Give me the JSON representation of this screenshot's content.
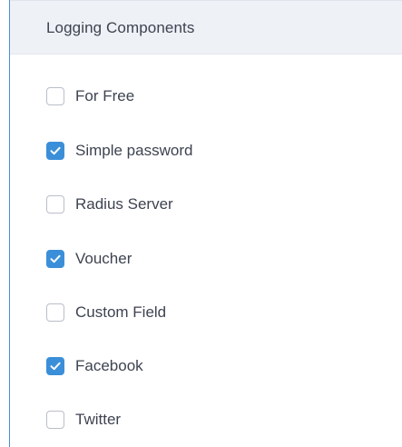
{
  "panel": {
    "title": "Logging Components"
  },
  "colors": {
    "accent": "#3b8fd9",
    "header_background": "#eef1f6",
    "text": "#3d4350"
  },
  "options": [
    {
      "label": "For Free",
      "checked": false
    },
    {
      "label": "Simple password",
      "checked": true
    },
    {
      "label": "Radius Server",
      "checked": false
    },
    {
      "label": "Voucher",
      "checked": true
    },
    {
      "label": "Custom Field",
      "checked": false
    },
    {
      "label": "Facebook",
      "checked": true
    },
    {
      "label": "Twitter",
      "checked": false
    }
  ]
}
